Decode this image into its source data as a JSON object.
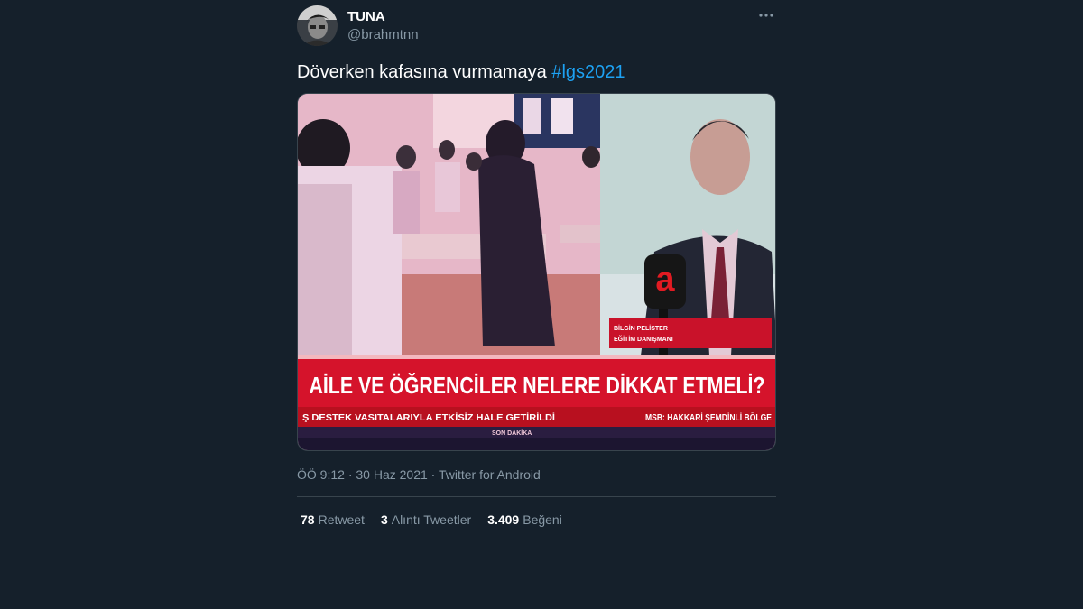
{
  "tweet": {
    "author": {
      "name": "TUNA",
      "handle": "@brahmtnn"
    },
    "text": "Döverken kafasına vurmamaya",
    "hashtag": "#lgs2021",
    "media": {
      "headline": "AİLE VE ÖĞRENCİLER NELERE DİKKAT ETMELİ?",
      "ticker_left": "Ş DESTEK VASITALARIYLA ETKİSİZ HALE GETİRİLDİ",
      "ticker_right": "MSB: HAKKARİ ŞEMDİNLİ BÖLGE",
      "lower_bar": "SON DAKİKA",
      "speaker_name": "BİLGİN PELİSTER",
      "speaker_title": "EĞİTİM DANIŞMANI",
      "channel_logo": "a"
    },
    "time": "ÖÖ 9:12",
    "date": "30 Haz 2021",
    "source": "Twitter for Android",
    "separator": "·",
    "stats": {
      "retweets_count": "78",
      "retweets_label": "Retweet",
      "quotes_count": "3",
      "quotes_label": "Alıntı Tweetler",
      "likes_count": "3.409",
      "likes_label": "Beğeni"
    }
  },
  "icons": {
    "more": "more-dots-icon"
  },
  "colors": {
    "background": "#15202b",
    "accent": "#1da1f2",
    "secondary_text": "#8899a6",
    "divider": "#38444d"
  }
}
